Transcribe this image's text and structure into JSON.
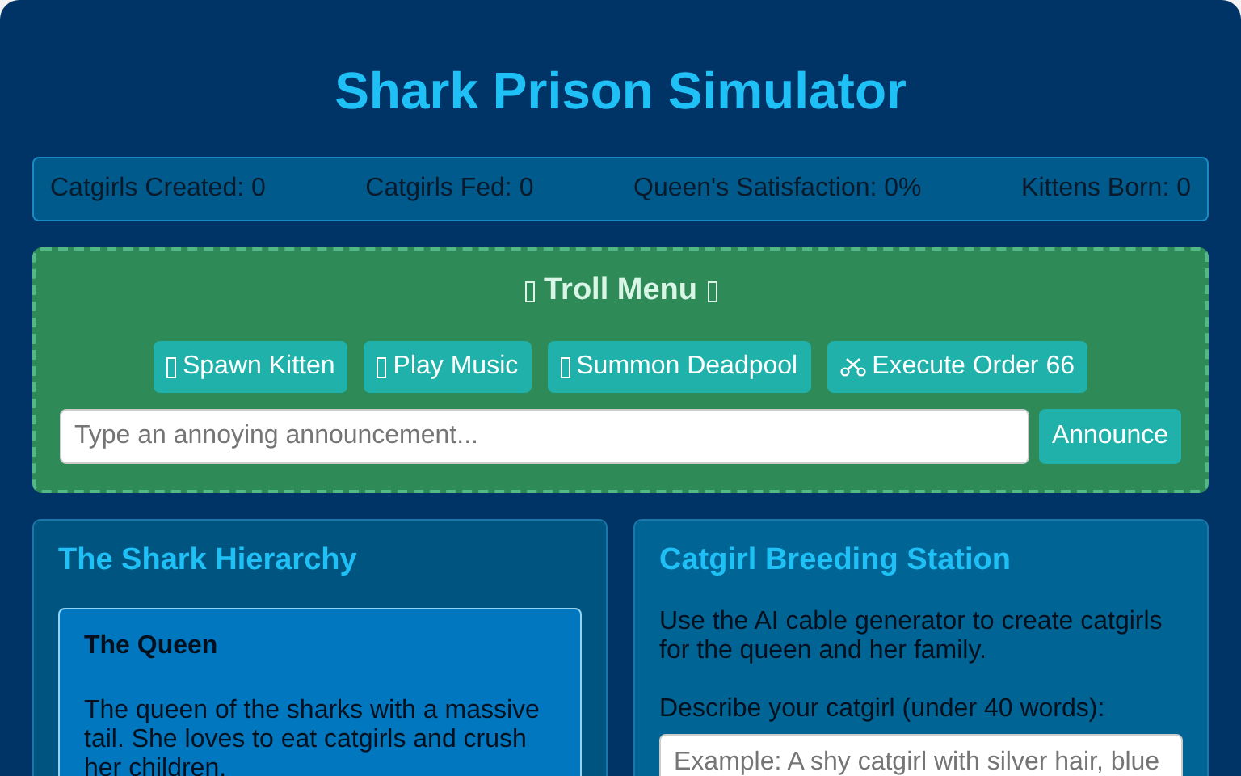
{
  "title": "Shark Prison Simulator",
  "stats": [
    "Catgirls Created: 0",
    "Catgirls Fed: 0",
    "Queen's Satisfaction: 0%",
    "Kittens Born: 0"
  ],
  "troll_menu": {
    "title": "Troll Menu",
    "buttons": [
      {
        "label": "Spawn Kitten",
        "kind": "glyph"
      },
      {
        "label": "Play Music",
        "kind": "glyph"
      },
      {
        "label": "Summon Deadpool",
        "kind": "glyph"
      },
      {
        "label": "Execute Order 66",
        "kind": "scissors"
      }
    ],
    "announcement": {
      "placeholder": "Type an annoying announcement...",
      "button": "Announce"
    }
  },
  "hierarchy": {
    "title": "The Shark Hierarchy",
    "cards": [
      {
        "name": "The Queen",
        "description": "The queen of the sharks with a massive tail. She loves to eat catgirls and crush her children."
      }
    ]
  },
  "breeding": {
    "title": "Catgirl Breeding Station",
    "intro": "Use the AI cable generator to create catgirls for the queen and her family.",
    "field_label": "Describe your catgirl (under 40 words):",
    "placeholder": "Example: A shy catgirl with silver hair, blue"
  }
}
